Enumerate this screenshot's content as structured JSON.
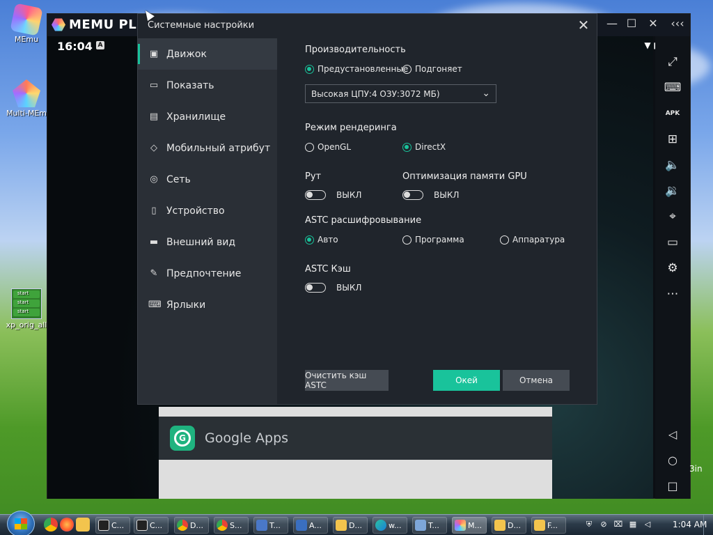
{
  "desktop": {
    "icons": [
      {
        "label": "MEmu",
        "icon": "memu-icon"
      },
      {
        "label": "Multi-MEm",
        "icon": "multi-memu-icon"
      },
      {
        "label": "xp_orig_all",
        "icon": "xp-shortcut-icon"
      }
    ],
    "xp_start_labels": [
      "start",
      "start",
      "start"
    ]
  },
  "emulator": {
    "brand": "MEMU PL",
    "time": "16:04",
    "notification_badge": "A",
    "window_controls": [
      "minimize-icon",
      "maximize-icon",
      "close-icon",
      "collapse-icon"
    ],
    "sidebar_tools": [
      "fullscreen-icon",
      "keyboard-icon",
      "apk-icon",
      "add-icon",
      "volume-up-icon",
      "volume-down-icon",
      "location-icon",
      "folder-icon",
      "settings-icon",
      "more-icon"
    ],
    "apk_label": "APK",
    "nav_buttons": [
      "back-icon",
      "home-icon",
      "recents-icon"
    ],
    "google_apps_label": "Google Apps",
    "partial_text": "3in"
  },
  "dialog": {
    "title": "Системные настройки",
    "nav_items": [
      {
        "label": "Движок",
        "icon": "engine-icon",
        "active": true
      },
      {
        "label": "Показать",
        "icon": "display-icon"
      },
      {
        "label": "Хранилище",
        "icon": "storage-icon"
      },
      {
        "label": "Мобильный атрибут",
        "icon": "tag-icon"
      },
      {
        "label": "Сеть",
        "icon": "network-icon"
      },
      {
        "label": "Устройство",
        "icon": "device-icon"
      },
      {
        "label": "Внешний вид",
        "icon": "appearance-icon"
      },
      {
        "label": "Предпочтение",
        "icon": "wrench-icon"
      },
      {
        "label": "Ярлыки",
        "icon": "keyboard-icon"
      }
    ],
    "performance": {
      "label": "Производительность",
      "options": [
        "Предустановленные",
        "Подгоняет"
      ],
      "selected": "Предустановленные",
      "select_value": "Высокая ЦПУ:4 ОЗУ:3072 МБ)"
    },
    "render": {
      "label": "Режим рендеринга",
      "options": [
        "OpenGL",
        "DirectX"
      ],
      "selected": "DirectX"
    },
    "root": {
      "label": "Рут",
      "state": "ВЫКЛ"
    },
    "gpu_memory": {
      "label": "Оптимизация памяти GPU",
      "state": "ВЫКЛ"
    },
    "astc_decode": {
      "label": "ASTC расшифровывание",
      "options": [
        "Авто",
        "Программа",
        "Аппаратура"
      ],
      "selected": "Авто"
    },
    "astc_cache": {
      "label": "ASTC Кэш",
      "state": "ВЫКЛ"
    },
    "buttons": {
      "clear_cache": "Очистить кэш ASTC",
      "ok": "Окей",
      "cancel": "Отмена"
    },
    "accent_color": "#19c39b"
  },
  "taskbar": {
    "pinned": [
      "chrome-icon",
      "firefox-icon",
      "explorer-icon"
    ],
    "tasks": [
      {
        "label": "C...",
        "icon": "7zip-icon"
      },
      {
        "label": "C...",
        "icon": "7zip-icon"
      },
      {
        "label": "D...",
        "icon": "chrome-icon"
      },
      {
        "label": "S...",
        "icon": "chrome-icon"
      },
      {
        "label": "T...",
        "icon": "app-icon"
      },
      {
        "label": "A...",
        "icon": "app-icon"
      },
      {
        "label": "D...",
        "icon": "folder-icon"
      },
      {
        "label": "w...",
        "icon": "edge-icon"
      },
      {
        "label": "T...",
        "icon": "app-icon"
      },
      {
        "label": "M...",
        "icon": "memu-icon",
        "active": true
      },
      {
        "label": "D...",
        "icon": "folder-icon"
      },
      {
        "label": "F...",
        "icon": "folder-icon"
      }
    ],
    "tray_icons": [
      "shield-icon",
      "network-off-icon",
      "volume-muted-icon",
      "network-icon",
      "mute-icon"
    ],
    "clock": "1:04 AM"
  }
}
